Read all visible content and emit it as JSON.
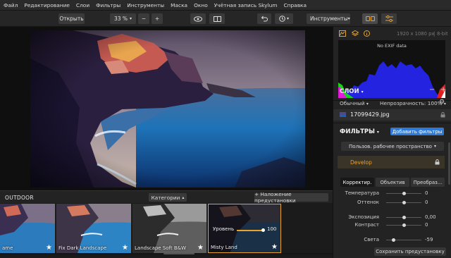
{
  "menu": [
    "Файл",
    "Редактирование",
    "Слои",
    "Фильтры",
    "Инструменты",
    "Маска",
    "Окно",
    "Учётная запись Skylum",
    "Справка"
  ],
  "toolbar": {
    "open_label": "Открыть",
    "zoom_value": "33 %",
    "zoom_minus": "−",
    "zoom_plus": "+",
    "tools_label": "Инструменты"
  },
  "presets": {
    "title": "OUTDOOR",
    "categories_label": "Категории",
    "overlay_label": "+ Наложение предустановки",
    "items": [
      {
        "label": "ame"
      },
      {
        "label": "Fix Dark Landscape"
      },
      {
        "label": "Landscape Soft B&W"
      },
      {
        "label": "Misty Land"
      }
    ],
    "amount_label": "Уровень",
    "amount_value": "100",
    "amount_level": 1.0
  },
  "panel": {
    "image_info": "1920 x 1080 px",
    "bit_depth": "8-bit",
    "exif": "No EXIF data",
    "layers_title": "СЛОИ",
    "blend_mode": "Обычный",
    "opacity": "Непрозрачность: 100%",
    "layer_name": "17099429.jpg",
    "filters_title": "ФИЛЬТРЫ",
    "add_filters_label": "Добавить фильтры",
    "workspace_label": "Пользов. рабочее пространство",
    "develop_label": "Develop",
    "tabs": [
      "Корректир.",
      "Объектив",
      "Преобраз..."
    ],
    "sliders": [
      {
        "label": "Температура",
        "value": "0",
        "level": 0.5
      },
      {
        "label": "Оттенок",
        "value": "0",
        "level": 0.5
      },
      {
        "label": "Экспозиция",
        "value": "0,00",
        "level": 0.5
      },
      {
        "label": "Контраст",
        "value": "0",
        "level": 0.5
      },
      {
        "label": "Света",
        "value": "-59",
        "level": 0.2
      }
    ],
    "save_preset_label": "Сохранить предустановку"
  },
  "colors": {
    "accent_blue": "#2f7ad6",
    "active_orange": "#e8a331",
    "panel_bg": "#232323"
  }
}
